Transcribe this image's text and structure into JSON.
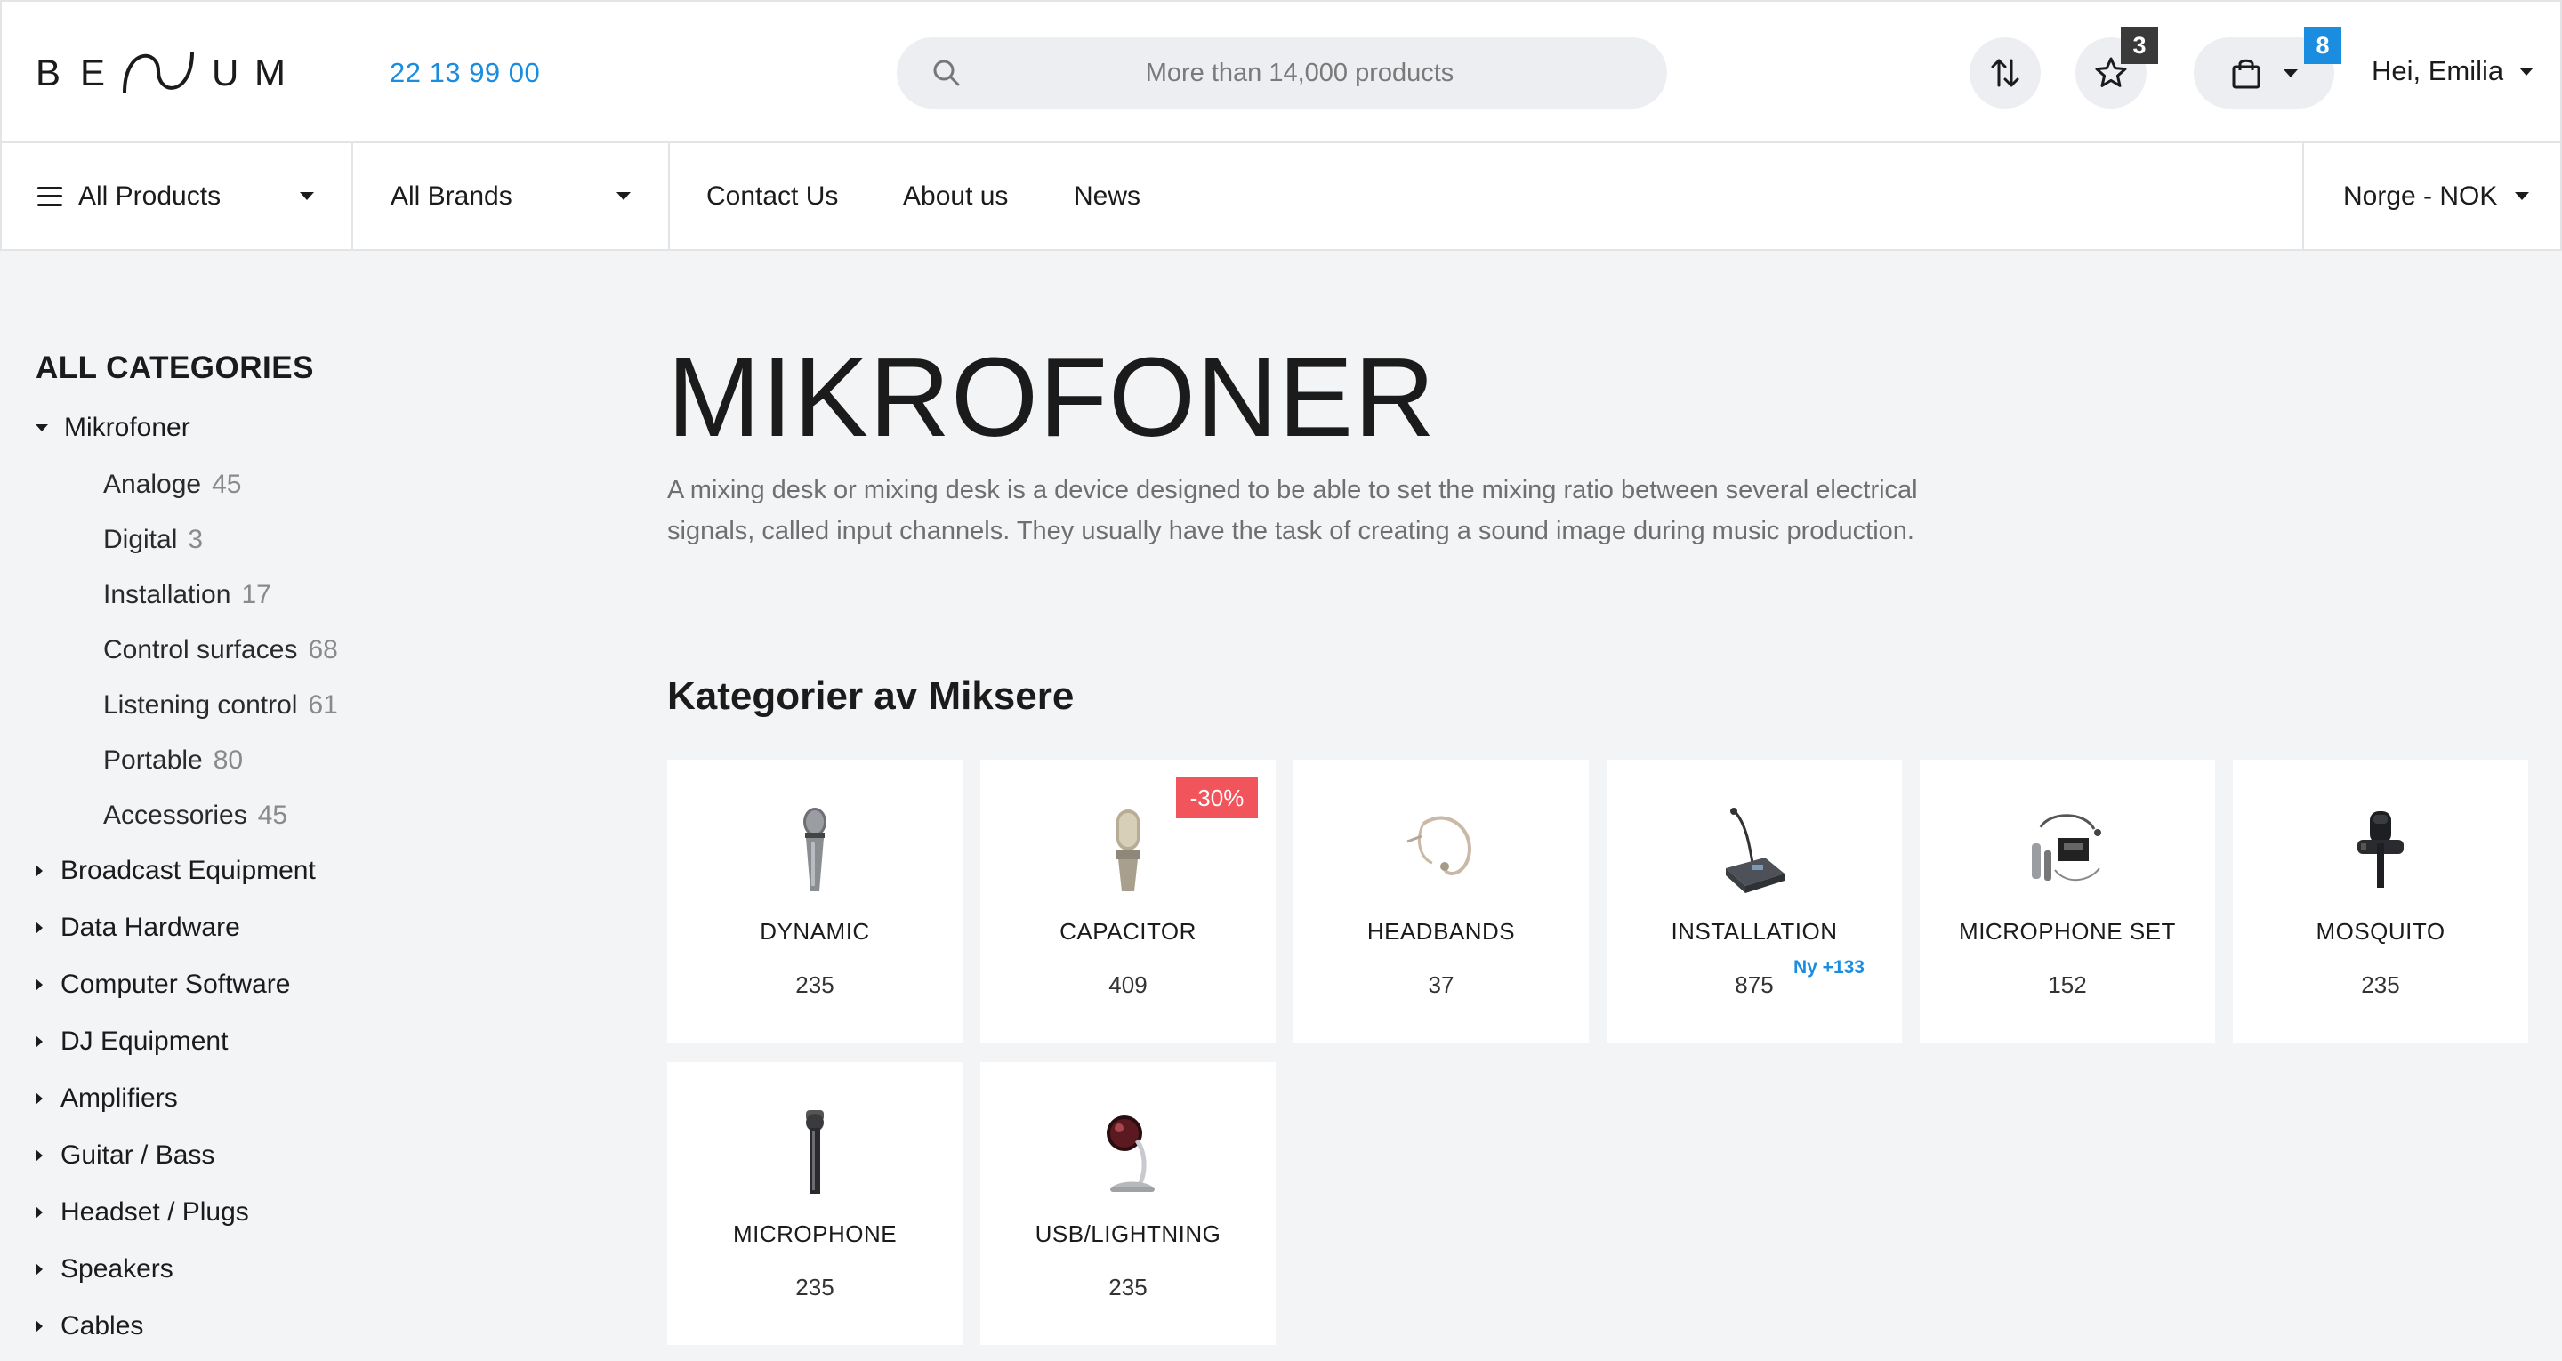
{
  "header": {
    "logo": "BENUM",
    "phone": "22 13 99 00",
    "search_placeholder": "More than 14,000 products",
    "favorites_count": "3",
    "cart_count": "8",
    "user_greeting": "Hei, Emilia"
  },
  "nav": {
    "all_products": "All Products",
    "all_brands": "All Brands",
    "contact": "Contact Us",
    "about": "About us",
    "news": "News",
    "region": "Norge - NOK"
  },
  "sidebar": {
    "title": "ALL CATEGORIES",
    "open_category": "Mikrofoner",
    "sub_items": [
      {
        "label": "Analoge",
        "count": "45"
      },
      {
        "label": "Digital",
        "count": "3"
      },
      {
        "label": "Installation",
        "count": "17"
      },
      {
        "label": "Control surfaces",
        "count": "68"
      },
      {
        "label": "Listening control",
        "count": "61"
      },
      {
        "label": "Portable",
        "count": "80"
      },
      {
        "label": "Accessories",
        "count": "45"
      }
    ],
    "categories": [
      "Broadcast Equipment",
      "Data Hardware",
      "Computer Software",
      "DJ Equipment",
      "Amplifiers",
      "Guitar / Bass",
      "Headset / Plugs",
      "Speakers",
      "Cables"
    ]
  },
  "main": {
    "title": "MIKROFONER",
    "description": "A mixing desk or mixing desk is a device designed to be able to set the mixing ratio between several electrical signals, called input channels. They usually have the task of creating a sound image during music production.",
    "section_title": "Kategorier av Miksere",
    "cards": [
      {
        "name": "DYNAMIC",
        "count": "235",
        "icon": "dynamic-mic-icon"
      },
      {
        "name": "CAPACITOR",
        "count": "409",
        "icon": "condenser-mic-icon",
        "badge": "-30%"
      },
      {
        "name": "HEADBANDS",
        "count": "37",
        "icon": "headband-mic-icon"
      },
      {
        "name": "INSTALLATION",
        "count": "875",
        "icon": "conference-mic-icon",
        "new": "Ny +133"
      },
      {
        "name": "MICROPHONE SET",
        "count": "152",
        "icon": "mic-set-icon"
      },
      {
        "name": "MOSQUITO",
        "count": "235",
        "icon": "lavalier-mic-icon"
      },
      {
        "name": "MICROPHONE",
        "count": "235",
        "icon": "shotgun-mic-icon"
      },
      {
        "name": "USB/LIGHTNING",
        "count": "235",
        "icon": "usb-mic-icon"
      }
    ]
  },
  "colors": {
    "accent": "#1a8de0",
    "sale": "#f2545b",
    "background": "#f3f4f5"
  }
}
